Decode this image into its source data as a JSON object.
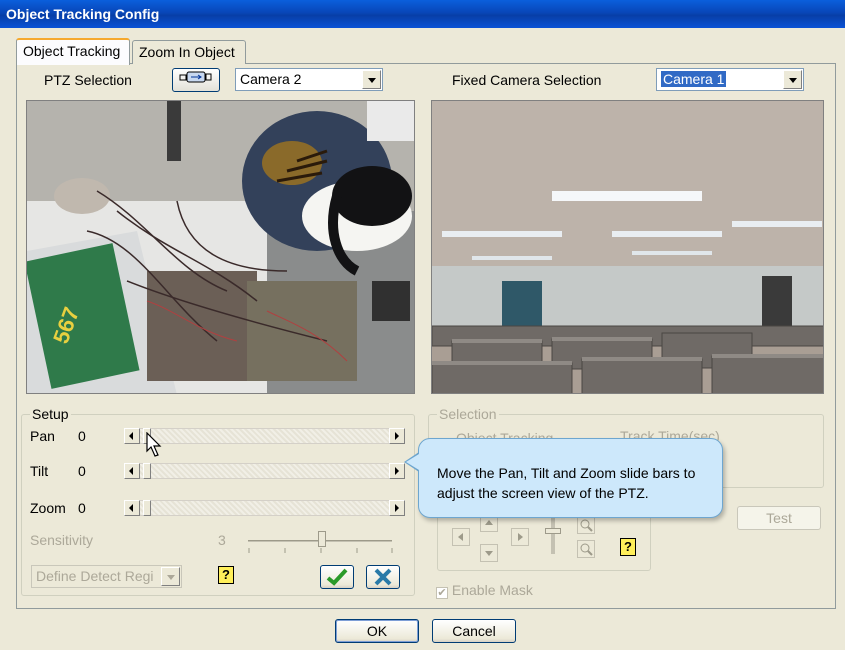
{
  "window": {
    "title": "Object Tracking Config"
  },
  "tabs": [
    {
      "label": "Object Tracking",
      "active": true
    },
    {
      "label": "Zoom In Object",
      "active": false
    }
  ],
  "ptz": {
    "label": "PTZ Selection",
    "value": "Camera 2"
  },
  "fixed": {
    "label": "Fixed Camera Selection",
    "value": "Camera 1"
  },
  "setup": {
    "title": "Setup",
    "pan": {
      "label": "Pan",
      "value": "0"
    },
    "tilt": {
      "label": "Tilt",
      "value": "0"
    },
    "zoom": {
      "label": "Zoom",
      "value": "0"
    },
    "sensitivity": {
      "label": "Sensitivity",
      "value": "3"
    },
    "define_region": "Define Detect Regi"
  },
  "selection": {
    "title": "Selection",
    "object_tracking": "Object Tracking",
    "track_time": "Track Time(sec)"
  },
  "tooltip": {
    "text": "Move the Pan, Tilt and Zoom slide bars to adjust the screen view of the PTZ."
  },
  "test_label": "Test",
  "enable_mask_label": "Enable Mask",
  "ok_label": "OK",
  "cancel_label": "Cancel",
  "colors": {
    "title_bar": "#0846b8",
    "tooltip_bg": "#cde8fb",
    "tab_highlight": "#f6a92d"
  },
  "icons": [
    "ptz-camera-icon",
    "help-icon",
    "check-icon",
    "x-icon",
    "arrow-up-icon",
    "arrow-down-icon",
    "arrow-left-icon",
    "arrow-right-icon",
    "zoom-in-icon",
    "zoom-out-icon"
  ]
}
